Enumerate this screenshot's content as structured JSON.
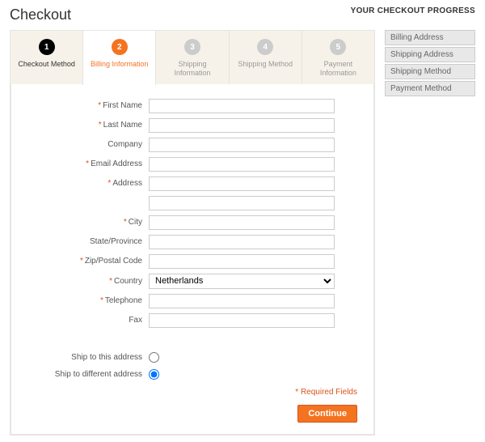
{
  "page": {
    "title": "Checkout"
  },
  "progress": {
    "title": "YOUR CHECKOUT PROGRESS",
    "items": [
      "Billing Address",
      "Shipping Address",
      "Shipping Method",
      "Payment Method"
    ]
  },
  "steps": [
    {
      "num": "1",
      "label": "Checkout Method",
      "state": "done"
    },
    {
      "num": "2",
      "label": "Billing Information",
      "state": "active"
    },
    {
      "num": "3",
      "label": "Shipping Information",
      "state": "pending"
    },
    {
      "num": "4",
      "label": "Shipping Method",
      "state": "pending"
    },
    {
      "num": "5",
      "label": "Payment Information",
      "state": "pending"
    }
  ],
  "form": {
    "fields": {
      "first_name": {
        "label": "First Name",
        "required": true,
        "value": ""
      },
      "last_name": {
        "label": "Last Name",
        "required": true,
        "value": ""
      },
      "company": {
        "label": "Company",
        "required": false,
        "value": ""
      },
      "email": {
        "label": "Email Address",
        "required": true,
        "value": ""
      },
      "address": {
        "label": "Address",
        "required": true,
        "value": ""
      },
      "address2": {
        "label": "",
        "required": false,
        "value": ""
      },
      "city": {
        "label": "City",
        "required": true,
        "value": ""
      },
      "state": {
        "label": "State/Province",
        "required": false,
        "value": ""
      },
      "zip": {
        "label": "Zip/Postal Code",
        "required": true,
        "value": ""
      },
      "country": {
        "label": "Country",
        "required": true,
        "value": "Netherlands"
      },
      "telephone": {
        "label": "Telephone",
        "required": true,
        "value": ""
      },
      "fax": {
        "label": "Fax",
        "required": false,
        "value": ""
      }
    },
    "ship_options": {
      "same": "Ship to this address",
      "diff": "Ship to different address",
      "selected": "diff"
    },
    "required_note": "* Required Fields",
    "continue_label": "Continue"
  }
}
